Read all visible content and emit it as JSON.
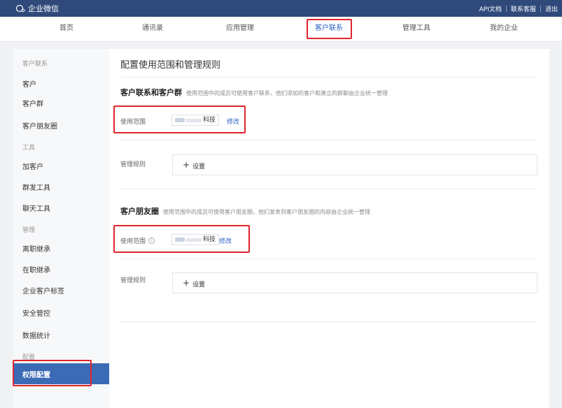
{
  "app": {
    "brand": "企业微信"
  },
  "toplinks": [
    "API文档",
    "联系客服",
    "退出"
  ],
  "nav": {
    "tabs": [
      "首页",
      "通讯录",
      "应用管理",
      "客户联系",
      "管理工具",
      "我的企业"
    ]
  },
  "sidebar": {
    "groups": [
      {
        "label": "客户联系",
        "items": [
          "客户",
          "客户群",
          "客户朋友圈"
        ]
      },
      {
        "label": "工具",
        "items": [
          "加客户",
          "群发工具",
          "聊天工具"
        ]
      },
      {
        "label": "管理",
        "items": [
          "离职继承",
          "在职继承",
          "企业客户标签",
          "安全管控",
          "数据统计"
        ]
      },
      {
        "label": "配置",
        "items": [
          "权限配置"
        ]
      }
    ]
  },
  "main": {
    "title": "配置使用范围和管理规则",
    "section1": {
      "title": "客户联系和客户群",
      "desc": "使用范围中的成员可使用客户联系，他们添加的客户和建立的群聊由企业统一管理",
      "scope_label": "使用范围",
      "scope_value": "科技",
      "edit": "修改",
      "rule_label": "管理规则",
      "rule_action": "设置"
    },
    "section2": {
      "title": "客户朋友圈",
      "desc": "使用范围中的成员可使用客户朋友圈，他们发表到客户朋友圈的内容由企业统一管理",
      "scope_label": "使用范围",
      "scope_value": "科技",
      "edit": "修改",
      "rule_label": "管理规则",
      "rule_action": "设置"
    }
  },
  "colors": {
    "topbar": "#2f4a7a",
    "active": "#3c6bb5",
    "link": "#2b62c4",
    "highlight": "#e0242c"
  }
}
